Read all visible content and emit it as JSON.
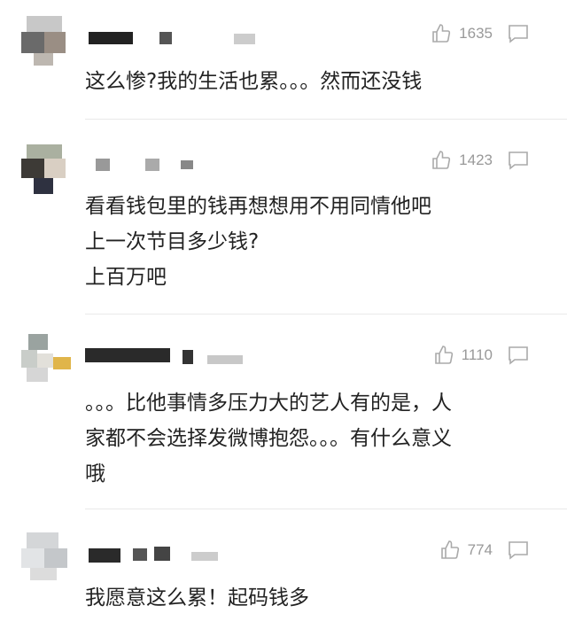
{
  "comments": [
    {
      "likes": "1635",
      "lines": [
        "这么惨?我的生活也累。。。然而还没钱"
      ]
    },
    {
      "likes": "1423",
      "lines": [
        "看看钱包里的钱再想想用不用同情他吧",
        "上一次节目多少钱?",
        "上百万吧"
      ]
    },
    {
      "likes": "1110",
      "lines": [
        "。。。比他事情多压力大的艺人有的是，人",
        "家都不会选择发微博抱怨。。。有什么意义",
        "哦"
      ]
    },
    {
      "likes": "774",
      "lines": [
        "我愿意这么累！起码钱多"
      ]
    }
  ],
  "icons": {
    "like": "thumbs-up-icon",
    "reply": "comment-bubble-icon"
  },
  "colors": {
    "meta": "#999999",
    "text": "#222222",
    "divider": "#e9e9e9"
  }
}
